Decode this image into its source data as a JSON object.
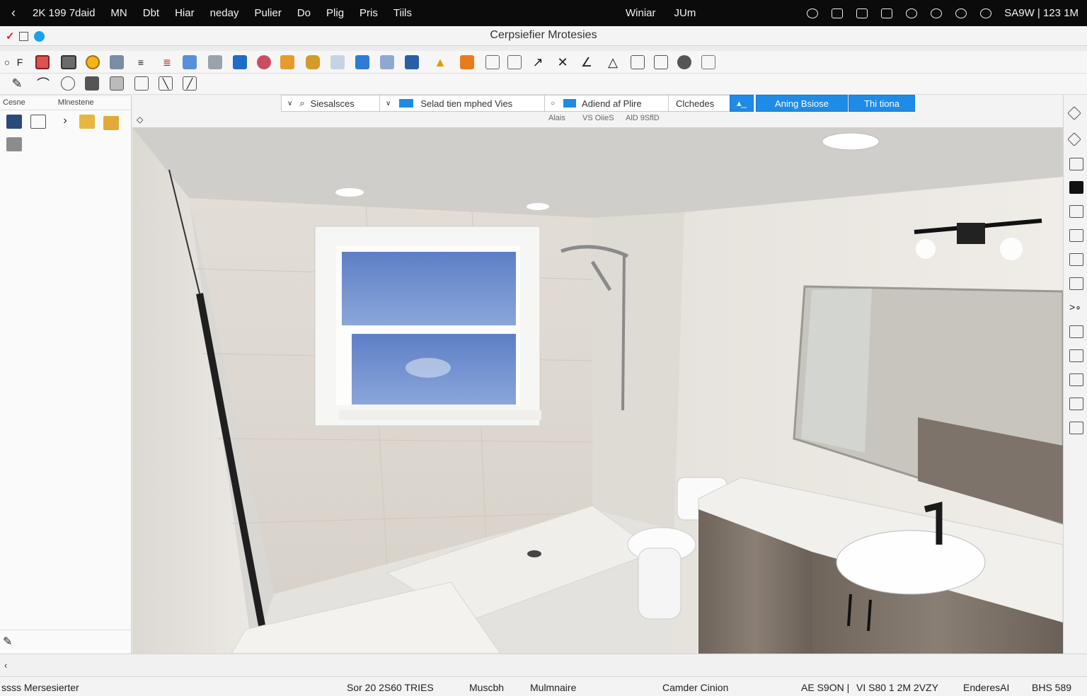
{
  "menubar": {
    "back_icon": "chevron-left-icon",
    "items": [
      "2K 199 7daid",
      "MN",
      "Dbt",
      "Hiar",
      "neday",
      "Pulier",
      "Do",
      "Plig",
      "Pris",
      "Tiils"
    ],
    "center_items": [
      "Winiar",
      "JUm"
    ],
    "status_icons": [
      "circle-icon",
      "window-icon",
      "square-icon",
      "display-icon",
      "wifi-icon",
      "pin-icon",
      "search-icon",
      "control-icon"
    ],
    "clock_text": "SA9W | 123 1M"
  },
  "window": {
    "title": "Cerpsiefier Mrotesies"
  },
  "toolbar1": {
    "icons": [
      "select-icon",
      "floorplan-icon",
      "wall-icon",
      "room-icon",
      "circle-icon",
      "door-icon",
      "stair-icon",
      "dimension-icon",
      "window-icon",
      "cabinet-icon",
      "color-icon",
      "elevation-icon",
      "furniture-icon",
      "tape-icon",
      "pointer-icon",
      "camera-icon",
      "monitor-icon",
      "light-icon",
      "material-icon",
      "table-icon",
      "grid-icon",
      "chevron-icon",
      "close-icon",
      "angle-icon",
      "triangle-icon",
      "square-icon",
      "column-icon",
      "sphere-icon",
      "page-icon"
    ]
  },
  "toolbar2": {
    "icons": [
      "edit-icon",
      "arc-icon",
      "oval-icon",
      "layout-icon",
      "image-icon",
      "frame-icon",
      "diagonal-icon",
      "pen-icon"
    ]
  },
  "sidepanel": {
    "tab1": "Cesne",
    "tab2": "Mlnestene",
    "icons": [
      "image-icon",
      "brush-icon",
      "chevron-right-icon",
      "folder-icon",
      "folder-open-icon",
      "photo-icon"
    ],
    "footer_icon": "edit-icon"
  },
  "viewbar": {
    "seg1": "Siesalsces",
    "seg2": "Selad tien mphed Vies",
    "seg3": "Adiend af Plire",
    "seg4": "Clchedes",
    "seg5_icon": "layers-icon",
    "seg6": "Aning Bsiose",
    "seg7": "Thi tiona",
    "sub1": "Alais",
    "sub2": "VS OiieS",
    "sub3": "AlD 9SflD"
  },
  "rightbar": {
    "icons": [
      "diamond-icon",
      "diamond-icon",
      "edit-icon",
      "frame-icon",
      "view-icon",
      "edit-icon",
      "view-icon",
      "folder-icon",
      "chevron-right-icon",
      "image-icon",
      "layers-icon",
      "grid-icon",
      "brush-icon",
      "camera-icon"
    ]
  },
  "statusbar": {
    "left": "ssss Mersesierter",
    "sort": "Sor 20 2S60 TRIES",
    "mode1": "Muscbh",
    "mode2": "Mulmnaire",
    "camera": "Camder Cinion",
    "coord1": "AE S9ON |",
    "coord2": "VI S80 1 2M 2VZY",
    "coord3": "EnderesAI",
    "coord4": "BHS 589"
  },
  "colors": {
    "accent": "#1e8be6",
    "menubar": "#0b0b0b",
    "close": "#d0282c"
  }
}
